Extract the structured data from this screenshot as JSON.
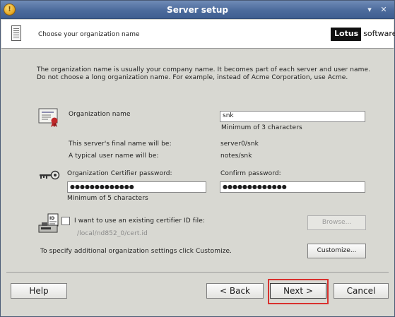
{
  "window": {
    "title": "Server setup",
    "minimize_glyph": "▾",
    "close_glyph": "✕"
  },
  "header": {
    "text": "Choose your organization name",
    "logo_left": "Lotus",
    "logo_right": "software"
  },
  "description": {
    "line1": "The organization name is usually your company name. It becomes part of each server and user name.",
    "line2": "Do not choose a long organization name. For example, instead of Acme Corporation, use Acme."
  },
  "org": {
    "label": "Organization name",
    "value": "snk",
    "hint": "Minimum of 3 characters",
    "final_name_label": "This server's final name will be:",
    "final_name_value": "server0/snk",
    "user_name_label": "A typical user name will be:",
    "user_name_value": "notes/snk"
  },
  "password": {
    "label": "Organization Certifier password:",
    "value": "●●●●●●●●●●●●●",
    "hint": "Minimum of 5 characters",
    "confirm_label": "Confirm password:",
    "confirm_value": "●●●●●●●●●●●●●"
  },
  "certifier": {
    "checkbox_label": "I want to use an existing certifier ID file:",
    "checked": false,
    "path": "/local/nd852_0/cert.id",
    "browse_label": "Browse..."
  },
  "customize": {
    "text": "To specify additional organization settings click Customize.",
    "button_label": "Customize..."
  },
  "footer": {
    "help_label": "Help",
    "back_label": "< Back",
    "next_label": "Next >",
    "cancel_label": "Cancel"
  },
  "colors": {
    "highlight": "#d9312e",
    "titlebar": "#4c6b9c"
  }
}
